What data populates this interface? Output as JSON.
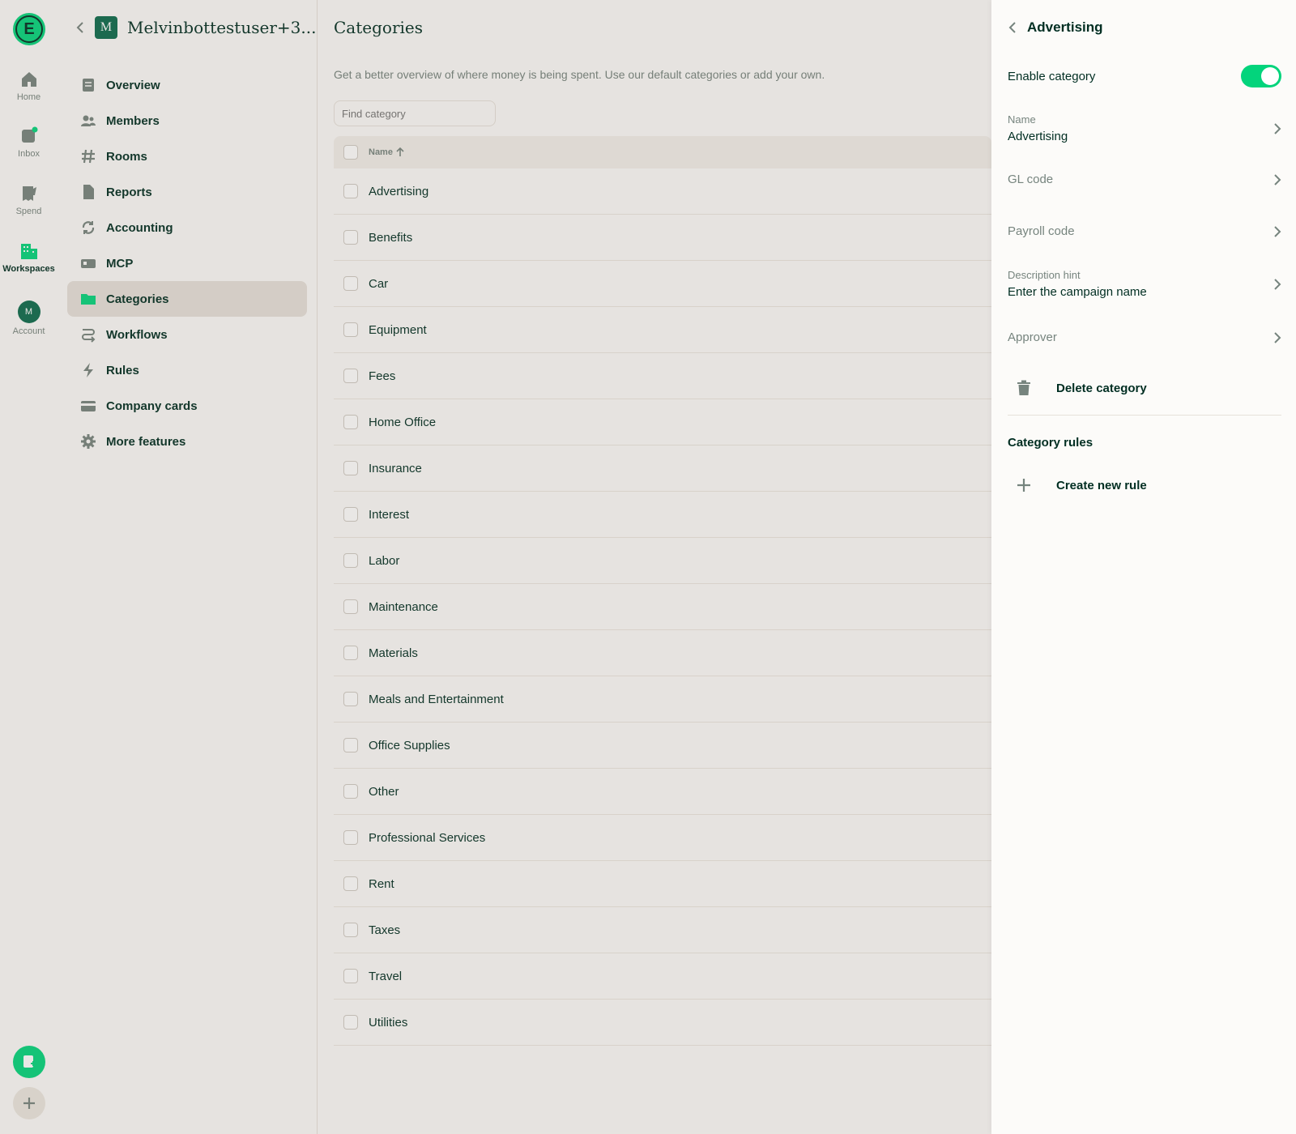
{
  "rail": {
    "items": [
      {
        "label": "Home"
      },
      {
        "label": "Inbox"
      },
      {
        "label": "Spend"
      },
      {
        "label": "Workspaces"
      },
      {
        "label": "Account"
      }
    ],
    "account_initial": "M",
    "logo_letter": "E"
  },
  "workspace": {
    "avatar_letter": "M",
    "name": "Melvinbottestuser+3...",
    "nav": [
      {
        "label": "Overview"
      },
      {
        "label": "Members"
      },
      {
        "label": "Rooms"
      },
      {
        "label": "Reports"
      },
      {
        "label": "Accounting"
      },
      {
        "label": "MCP"
      },
      {
        "label": "Categories"
      },
      {
        "label": "Workflows"
      },
      {
        "label": "Rules"
      },
      {
        "label": "Company cards"
      },
      {
        "label": "More features"
      }
    ]
  },
  "main": {
    "title": "Categories",
    "subtitle": "Get a better overview of where money is being spent. Use our default categories or add your own.",
    "search_placeholder": "Find category",
    "column_name": "Name",
    "rows": [
      "Advertising",
      "Benefits",
      "Car",
      "Equipment",
      "Fees",
      "Home Office",
      "Insurance",
      "Interest",
      "Labor",
      "Maintenance",
      "Materials",
      "Meals and Entertainment",
      "Office Supplies",
      "Other",
      "Professional Services",
      "Rent",
      "Taxes",
      "Travel",
      "Utilities"
    ]
  },
  "panel": {
    "title": "Advertising",
    "enable_label": "Enable category",
    "enabled": true,
    "name_label": "Name",
    "name_value": "Advertising",
    "gl_code_label": "GL code",
    "payroll_code_label": "Payroll code",
    "description_hint_label": "Description hint",
    "description_hint_value": "Enter the campaign name",
    "approver_label": "Approver",
    "delete_label": "Delete category",
    "rules_section": "Category rules",
    "create_rule_label": "Create new rule"
  },
  "colors": {
    "accent": "#03d47c",
    "text": "#002e22",
    "muted": "#76847e"
  }
}
